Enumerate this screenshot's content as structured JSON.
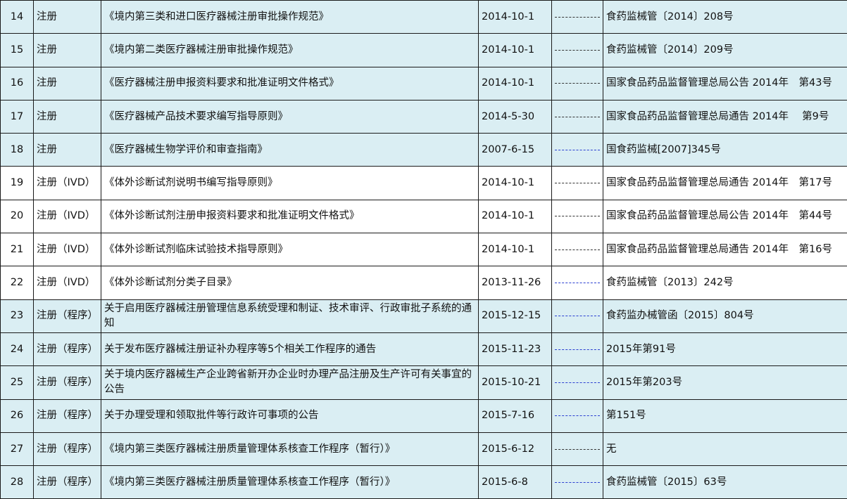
{
  "rows": [
    {
      "num": "14",
      "type": "注册",
      "title": "《境内第三类和进口医疗器械注册审批操作规范》",
      "date": "2014-10-1",
      "link_color": "dark",
      "doc": "食药监械管〔2014〕208号",
      "shade": "blue"
    },
    {
      "num": "15",
      "type": "注册",
      "title": "《境内第二类医疗器械注册审批操作规范》",
      "date": "2014-10-1",
      "link_color": "dark",
      "doc": "食药监械管〔2014〕209号",
      "shade": "blue"
    },
    {
      "num": "16",
      "type": "注册",
      "title": "《医疗器械注册申报资料要求和批准证明文件格式》",
      "date": "2014-10-1",
      "link_color": "dark",
      "doc": "国家食品药品监督管理总局公告 2014年　第43号",
      "shade": "blue"
    },
    {
      "num": "17",
      "type": "注册",
      "title": "《医疗器械产品技术要求编写指导原则》",
      "date": "2014-5-30",
      "link_color": "dark",
      "doc": "国家食品药品监督管理总局通告 2014年　 第9号",
      "shade": "blue"
    },
    {
      "num": "18",
      "type": "注册",
      "title": "《医疗器械生物学评价和审查指南》",
      "date": "2007-6-15",
      "link_color": "blue",
      "doc": "国食药监械[2007]345号",
      "shade": "blue"
    },
    {
      "num": "19",
      "type": "注册（IVD）",
      "title": "《体外诊断试剂说明书编写指导原则》",
      "date": "2014-10-1",
      "link_color": "dark",
      "doc": "国家食品药品监督管理总局通告 2014年　第17号",
      "shade": "white"
    },
    {
      "num": "20",
      "type": "注册（IVD）",
      "title": "《体外诊断试剂注册申报资料要求和批准证明文件格式》",
      "date": "2014-10-1",
      "link_color": "dark",
      "doc": "国家食品药品监督管理总局公告 2014年　第44号",
      "shade": "white"
    },
    {
      "num": "21",
      "type": "注册（IVD）",
      "title": "《体外诊断试剂临床试验技术指导原则》",
      "date": "2014-10-1",
      "link_color": "dark",
      "doc": "国家食品药品监督管理总局通告 2014年　第16号",
      "shade": "white"
    },
    {
      "num": "22",
      "type": "注册（IVD）",
      "title": "《体外诊断试剂分类子目录》",
      "date": "2013-11-26",
      "link_color": "blue",
      "doc": "食药监械管〔2013〕242号",
      "shade": "white"
    },
    {
      "num": "23",
      "type": "注册（程序）",
      "title": "关于启用医疗器械注册管理信息系统受理和制证、技术审评、行政审批子系统的通知",
      "date": "2015-12-15",
      "link_color": "blue",
      "doc": "食药监办械管函〔2015〕804号",
      "shade": "blue",
      "wrap": true
    },
    {
      "num": "24",
      "type": "注册（程序）",
      "title": "关于发布医疗器械注册证补办程序等5个相关工作程序的通告",
      "date": "2015-11-23",
      "link_color": "blue",
      "doc": "2015年第91号",
      "shade": "blue"
    },
    {
      "num": "25",
      "type": "注册（程序）",
      "title": "关于境内医疗器械生产企业跨省新开办企业时办理产品注册及生产许可有关事宜的公告",
      "date": "2015-10-21",
      "link_color": "blue",
      "doc": "2015年第203号",
      "shade": "blue",
      "wrap": true
    },
    {
      "num": "26",
      "type": "注册（程序）",
      "title": "关于办理受理和领取批件等行政许可事项的公告",
      "date": "2015-7-16",
      "link_color": "blue",
      "doc": "第151号",
      "shade": "blue"
    },
    {
      "num": "27",
      "type": "注册（程序）",
      "title": "《境内第三类医疗器械注册质量管理体系核查工作程序（暂行）》",
      "date": "2015-6-12",
      "link_color": "dark",
      "doc": "无",
      "shade": "blue"
    },
    {
      "num": "28",
      "type": "注册（程序）",
      "title": "《境内第三类医疗器械注册质量管理体系核查工作程序（暂行）》",
      "date": "2015-6-8",
      "link_color": "blue",
      "doc": "食药监械管〔2015〕63号",
      "shade": "blue"
    }
  ]
}
